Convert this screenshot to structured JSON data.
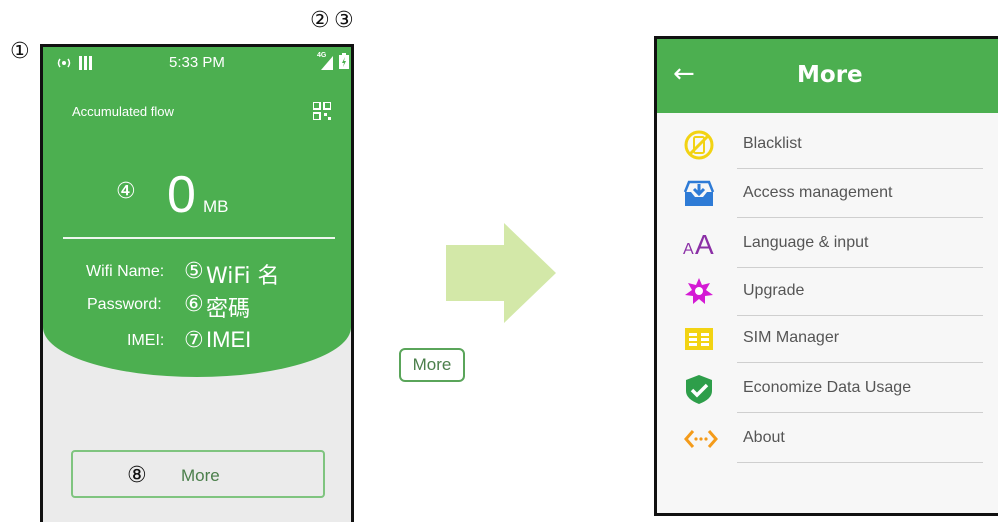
{
  "callouts": [
    "①",
    "②",
    "③",
    "④",
    "⑤",
    "⑥",
    "⑦",
    "⑧"
  ],
  "left_phone": {
    "status_time": "5:33 PM",
    "network_label": "4G",
    "accumulated_label": "Accumulated flow",
    "flow_value": "0",
    "flow_unit": "MB",
    "wifi_name_label": "Wifi Name:",
    "wifi_name_value": "WiFi 名",
    "password_label": "Password:",
    "password_value": "密碼",
    "imei_label": "IMEI:",
    "imei_value": "IMEI",
    "more_label": "More"
  },
  "chip_label": "More",
  "right_phone": {
    "title": "More",
    "back_icon": "back-arrow-icon",
    "menu": [
      {
        "label": "Blacklist",
        "icon": "blacklist-icon"
      },
      {
        "label": "Access management",
        "icon": "access-management-icon"
      },
      {
        "label": "Language & input",
        "icon": "language-icon"
      },
      {
        "label": "Upgrade",
        "icon": "upgrade-icon"
      },
      {
        "label": "SIM Manager",
        "icon": "sim-manager-icon"
      },
      {
        "label": "Economize Data Usage",
        "icon": "economize-data-icon"
      },
      {
        "label": "About",
        "icon": "about-icon"
      }
    ]
  },
  "colors": {
    "green": "#4caf50",
    "arrow_green": "#d3e8a8",
    "menu_yellow": "#f2d313",
    "menu_blue": "#2e7bd6",
    "menu_purple": "#8b2fa6",
    "menu_magenta": "#d41ad4",
    "menu_orange": "#f49b1a"
  }
}
